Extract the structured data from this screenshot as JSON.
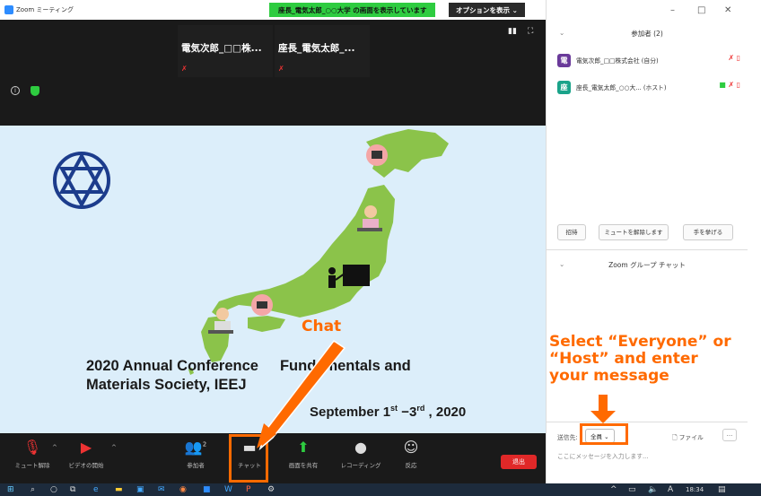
{
  "window": {
    "title": "Zoom ミーティング"
  },
  "banner": {
    "sharing_text": "座長_電気太郎_○○大学 の画面を表示しています",
    "options_label": "オプションを表示 ⌄"
  },
  "video_tiles": [
    {
      "name": "電気次郎_□□株..."
    },
    {
      "name": "座長_電気太郎_..."
    }
  ],
  "slide": {
    "title_line1": "2020 Annual Conference",
    "title_line1b": "Fundamentals and",
    "title_line2": "Materials Society, IEEJ",
    "date_prefix": "September 1",
    "date_sup1": "st",
    "date_mid": " −3",
    "date_sup2": "rd",
    "date_suffix": " , 2020"
  },
  "toolbar": {
    "mute_label": "ミュート解除",
    "video_label": "ビデオの開始",
    "participants_label": "参加者",
    "participants_count": "2",
    "chat_label": "チャット",
    "share_label": "画面を共有",
    "record_label": "レコーディング",
    "reactions_label": "反応",
    "end_label": "退出"
  },
  "panel": {
    "window_controls": {
      "minimize": "–",
      "restore": "□",
      "close": "✕"
    },
    "participants_header": "参加者 (2)",
    "participants": [
      {
        "avatar": "電",
        "avatar_color": "#6a3a9a",
        "name": "電気次郎_□□株式会社 (自分)"
      },
      {
        "avatar": "座",
        "avatar_color": "#1aa38a",
        "name": "座長_電気太郎_○○大... (ホスト)"
      }
    ],
    "invite_label": "招待",
    "unmute_label": "ミュートを解除します",
    "raise_hand_label": "手を挙げる",
    "chat_header": "Zoom グループ チャット",
    "send_to_label": "送信先:",
    "recipient_label": "全員 ⌄",
    "file_label": "ファイル",
    "more_label": "...",
    "message_placeholder": "ここにメッセージを入力します..."
  },
  "annotations": {
    "chat": "Chat",
    "select_line1": "Select “Everyone” or",
    "select_line2": "“Host” and enter",
    "select_line3": "your message"
  },
  "taskbar": {
    "time": "18:34",
    "ime": "A"
  },
  "colors": {
    "accent": "#ff6a00",
    "share_green": "#2ecc40",
    "end_red": "#e02828",
    "map_green": "#8bc34a"
  }
}
